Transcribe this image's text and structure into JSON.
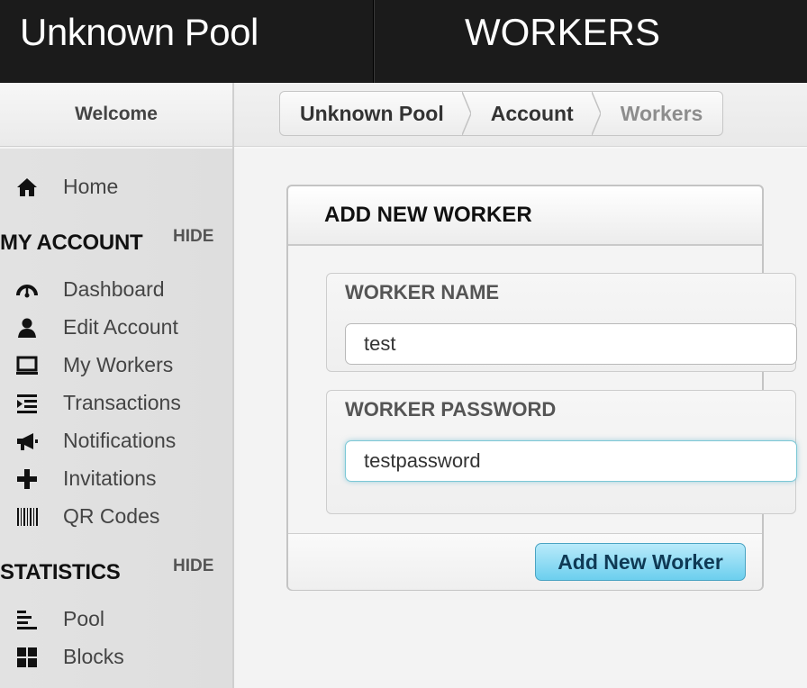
{
  "header": {
    "brand": "Unknown Pool",
    "page_title": "WORKERS"
  },
  "sidebar": {
    "welcome": "Welcome",
    "home": {
      "label": "Home",
      "icon": "home-icon"
    },
    "my_account": {
      "title": "MY ACCOUNT",
      "hide_label": "HIDE",
      "items": [
        {
          "label": "Dashboard",
          "icon": "dashboard-gauge-icon"
        },
        {
          "label": "Edit Account",
          "icon": "user-icon"
        },
        {
          "label": "My Workers",
          "icon": "laptop-icon"
        },
        {
          "label": "Transactions",
          "icon": "transactions-list-icon"
        },
        {
          "label": "Notifications",
          "icon": "megaphone-icon"
        },
        {
          "label": "Invitations",
          "icon": "plus-icon"
        },
        {
          "label": "QR Codes",
          "icon": "barcode-icon"
        }
      ]
    },
    "statistics": {
      "title": "STATISTICS",
      "hide_label": "HIDE",
      "items": [
        {
          "label": "Pool",
          "icon": "bar-chart-icon"
        },
        {
          "label": "Blocks",
          "icon": "grid-icon"
        }
      ]
    }
  },
  "breadcrumb": [
    "Unknown Pool",
    "Account",
    "Workers"
  ],
  "form": {
    "title": "ADD NEW WORKER",
    "worker_name": {
      "label": "WORKER NAME",
      "value": "test"
    },
    "worker_password": {
      "label": "WORKER PASSWORD",
      "value": "testpassword"
    },
    "submit_label": "Add New Worker"
  },
  "colors": {
    "header_bg": "#1b1b1b",
    "sidebar_bg": "#e0e0e0",
    "button_accent": "#6ccfee",
    "focus_ring": "#7cc8d6"
  }
}
